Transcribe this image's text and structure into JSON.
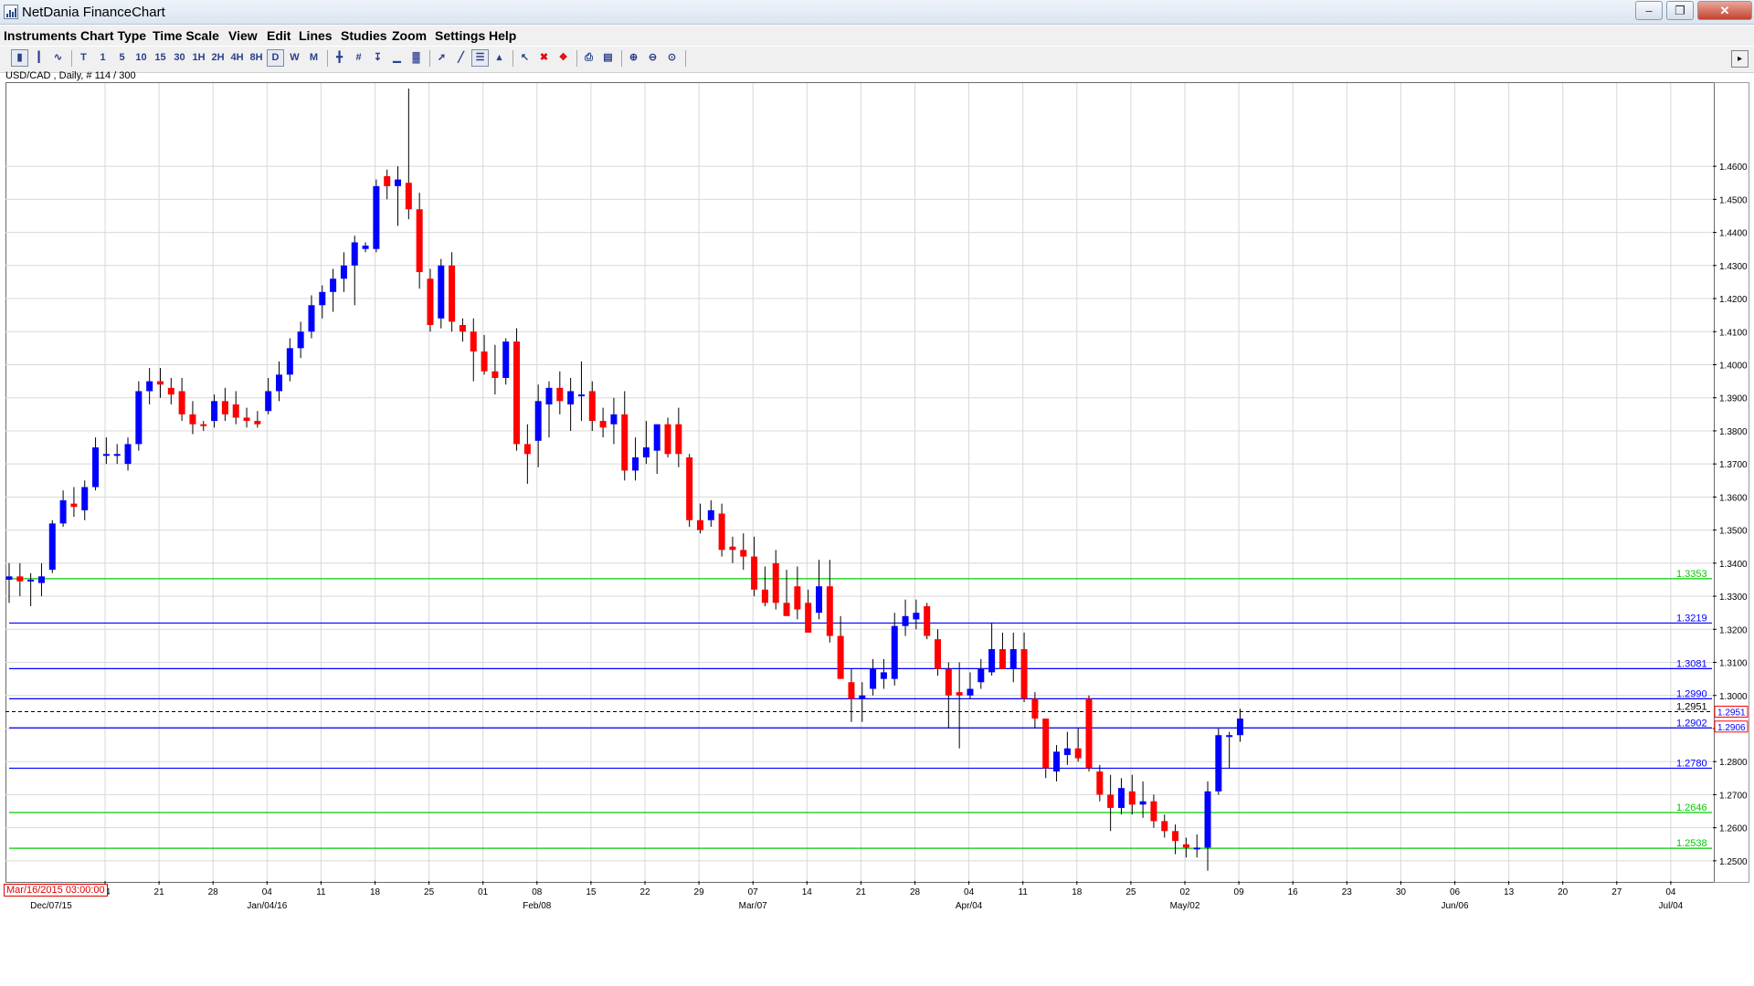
{
  "window": {
    "title": "NetDania FinanceChart",
    "controls": [
      "minimize",
      "maximize",
      "close"
    ]
  },
  "menu": [
    "Instruments",
    "Chart Type",
    "Time Scale",
    "View",
    "Edit",
    "Lines",
    "Studies",
    "Zoom",
    "Settings",
    "Help"
  ],
  "toolbar": {
    "timescale_buttons": [
      "T",
      "1",
      "5",
      "10",
      "15",
      "30",
      "1H",
      "2H",
      "4H",
      "8H",
      "D",
      "W",
      "M"
    ],
    "selected_timescale": "D"
  },
  "chart_label": "USD/CAD , Daily, # 114 / 300",
  "crosshair_date": "Mar/16/2015 03:00:00",
  "colors": {
    "bull": "#0000ff",
    "bear": "#ff0000",
    "support_line": "#00cc00",
    "resistance_line": "#0000ff",
    "current_price_line": "#000000",
    "grid": "#d8d8d8"
  },
  "chart_data": {
    "type": "candlestick",
    "symbol": "USD/CAD",
    "interval": "Daily",
    "ylim": [
      1.245,
      1.4835
    ],
    "yticks": [
      "1.2500",
      "1.2600",
      "1.2700",
      "1.2800",
      "1.2900",
      "1.3000",
      "1.3100",
      "1.3200",
      "1.3300",
      "1.3400",
      "1.3500",
      "1.3600",
      "1.3700",
      "1.3800",
      "1.3900",
      "1.4000",
      "1.4100",
      "1.4200",
      "1.4300",
      "1.4400",
      "1.4500",
      "1.4600"
    ],
    "xticks": [
      "14",
      "21",
      "28",
      "04",
      "11",
      "18",
      "25",
      "01",
      "08",
      "15",
      "22",
      "29",
      "07",
      "14",
      "21",
      "28",
      "04",
      "11",
      "18",
      "25",
      "02",
      "09",
      "16",
      "23",
      "30",
      "06",
      "13",
      "20",
      "27",
      "04"
    ],
    "month_labels": [
      {
        "tick_index": -1,
        "text": "Dec/07/15"
      },
      {
        "tick_index": 3,
        "text": "Jan/04/16"
      },
      {
        "tick_index": 8,
        "text": "Feb/08"
      },
      {
        "tick_index": 12,
        "text": "Mar/07"
      },
      {
        "tick_index": 16,
        "text": "Apr/04"
      },
      {
        "tick_index": 20,
        "text": "May/02"
      },
      {
        "tick_index": 25,
        "text": "Jun/06"
      },
      {
        "tick_index": 29,
        "text": "Jul/04"
      }
    ],
    "hlines": [
      {
        "value": 1.3353,
        "label": "1.3353",
        "color": "#00cc00"
      },
      {
        "value": 1.3219,
        "label": "1.3219",
        "color": "#0000ff"
      },
      {
        "value": 1.3081,
        "label": "1.3081",
        "color": "#0000ff"
      },
      {
        "value": 1.299,
        "label": "1.2990",
        "color": "#0000ff"
      },
      {
        "value": 1.2902,
        "label": "1.2902",
        "color": "#0000ff"
      },
      {
        "value": 1.278,
        "label": "1.2780",
        "color": "#0000ff"
      },
      {
        "value": 1.2646,
        "label": "1.2646",
        "color": "#00cc00"
      },
      {
        "value": 1.2538,
        "label": "1.2538",
        "color": "#00cc00"
      }
    ],
    "current_price": {
      "value": 1.2951,
      "label": "1.2951"
    },
    "axis_markers": [
      {
        "value": 1.2951,
        "label": "1.2951"
      },
      {
        "value": 1.2906,
        "label": "1.2906"
      }
    ],
    "candles": [
      [
        1.335,
        1.34,
        1.328,
        1.336
      ],
      [
        1.336,
        1.34,
        1.33,
        1.3345
      ],
      [
        1.3345,
        1.337,
        1.327,
        1.335
      ],
      [
        1.334,
        1.34,
        1.33,
        1.336
      ],
      [
        1.338,
        1.353,
        1.337,
        1.352
      ],
      [
        1.352,
        1.362,
        1.351,
        1.359
      ],
      [
        1.358,
        1.363,
        1.354,
        1.357
      ],
      [
        1.356,
        1.365,
        1.353,
        1.363
      ],
      [
        1.363,
        1.378,
        1.362,
        1.375
      ],
      [
        1.373,
        1.378,
        1.37,
        1.373
      ],
      [
        1.373,
        1.376,
        1.37,
        1.373
      ],
      [
        1.37,
        1.378,
        1.368,
        1.376
      ],
      [
        1.376,
        1.395,
        1.374,
        1.392
      ],
      [
        1.392,
        1.399,
        1.388,
        1.395
      ],
      [
        1.395,
        1.399,
        1.39,
        1.394
      ],
      [
        1.393,
        1.396,
        1.388,
        1.391
      ],
      [
        1.392,
        1.396,
        1.383,
        1.385
      ],
      [
        1.385,
        1.389,
        1.379,
        1.382
      ],
      [
        1.382,
        1.383,
        1.38,
        1.3815
      ],
      [
        1.383,
        1.391,
        1.381,
        1.389
      ],
      [
        1.389,
        1.393,
        1.383,
        1.385
      ],
      [
        1.388,
        1.392,
        1.382,
        1.384
      ],
      [
        1.384,
        1.387,
        1.381,
        1.383
      ],
      [
        1.383,
        1.386,
        1.381,
        1.382
      ],
      [
        1.386,
        1.396,
        1.385,
        1.392
      ],
      [
        1.392,
        1.401,
        1.389,
        1.397
      ],
      [
        1.397,
        1.408,
        1.395,
        1.405
      ],
      [
        1.405,
        1.413,
        1.402,
        1.41
      ],
      [
        1.41,
        1.421,
        1.408,
        1.418
      ],
      [
        1.418,
        1.424,
        1.414,
        1.422
      ],
      [
        1.422,
        1.429,
        1.416,
        1.426
      ],
      [
        1.426,
        1.434,
        1.422,
        1.43
      ],
      [
        1.43,
        1.439,
        1.418,
        1.437
      ],
      [
        1.435,
        1.437,
        1.434,
        1.436
      ],
      [
        1.435,
        1.456,
        1.434,
        1.454
      ],
      [
        1.457,
        1.459,
        1.45,
        1.454
      ],
      [
        1.454,
        1.46,
        1.442,
        1.456
      ],
      [
        1.455,
        1.4835,
        1.444,
        1.447
      ],
      [
        1.447,
        1.452,
        1.423,
        1.428
      ],
      [
        1.426,
        1.429,
        1.41,
        1.412
      ],
      [
        1.414,
        1.432,
        1.411,
        1.43
      ],
      [
        1.43,
        1.434,
        1.41,
        1.413
      ],
      [
        1.412,
        1.414,
        1.407,
        1.41
      ],
      [
        1.41,
        1.414,
        1.395,
        1.404
      ],
      [
        1.404,
        1.409,
        1.397,
        1.398
      ],
      [
        1.398,
        1.406,
        1.391,
        1.396
      ],
      [
        1.396,
        1.408,
        1.394,
        1.407
      ],
      [
        1.407,
        1.411,
        1.374,
        1.376
      ],
      [
        1.376,
        1.382,
        1.364,
        1.373
      ],
      [
        1.377,
        1.394,
        1.369,
        1.389
      ],
      [
        1.388,
        1.395,
        1.378,
        1.393
      ],
      [
        1.393,
        1.398,
        1.385,
        1.389
      ],
      [
        1.388,
        1.396,
        1.38,
        1.392
      ],
      [
        1.391,
        1.401,
        1.383,
        1.391
      ],
      [
        1.392,
        1.395,
        1.38,
        1.383
      ],
      [
        1.383,
        1.387,
        1.378,
        1.381
      ],
      [
        1.382,
        1.39,
        1.376,
        1.385
      ],
      [
        1.385,
        1.392,
        1.365,
        1.368
      ],
      [
        1.368,
        1.378,
        1.365,
        1.372
      ],
      [
        1.372,
        1.383,
        1.37,
        1.375
      ],
      [
        1.374,
        1.381,
        1.367,
        1.382
      ],
      [
        1.382,
        1.384,
        1.372,
        1.373
      ],
      [
        1.382,
        1.387,
        1.369,
        1.373
      ],
      [
        1.372,
        1.373,
        1.351,
        1.353
      ],
      [
        1.353,
        1.358,
        1.349,
        1.35
      ],
      [
        1.353,
        1.359,
        1.351,
        1.356
      ],
      [
        1.355,
        1.358,
        1.342,
        1.344
      ],
      [
        1.345,
        1.348,
        1.34,
        1.344
      ],
      [
        1.344,
        1.349,
        1.338,
        1.342
      ],
      [
        1.342,
        1.348,
        1.33,
        1.332
      ],
      [
        1.332,
        1.339,
        1.327,
        1.328
      ],
      [
        1.34,
        1.344,
        1.326,
        1.328
      ],
      [
        1.328,
        1.338,
        1.325,
        1.324
      ],
      [
        1.333,
        1.339,
        1.323,
        1.326
      ],
      [
        1.328,
        1.332,
        1.321,
        1.319
      ],
      [
        1.325,
        1.341,
        1.323,
        1.333
      ],
      [
        1.333,
        1.341,
        1.316,
        1.318
      ],
      [
        1.318,
        1.324,
        1.305,
        1.305
      ],
      [
        1.304,
        1.308,
        1.292,
        1.299
      ],
      [
        1.299,
        1.304,
        1.292,
        1.3
      ],
      [
        1.302,
        1.311,
        1.3,
        1.308
      ],
      [
        1.305,
        1.311,
        1.302,
        1.307
      ],
      [
        1.305,
        1.325,
        1.303,
        1.321
      ],
      [
        1.321,
        1.329,
        1.318,
        1.324
      ],
      [
        1.323,
        1.329,
        1.32,
        1.325
      ],
      [
        1.327,
        1.328,
        1.317,
        1.318
      ],
      [
        1.317,
        1.32,
        1.306,
        1.308
      ],
      [
        1.308,
        1.31,
        1.29,
        1.3
      ],
      [
        1.301,
        1.31,
        1.284,
        1.3
      ],
      [
        1.3,
        1.307,
        1.299,
        1.302
      ],
      [
        1.304,
        1.311,
        1.302,
        1.308
      ],
      [
        1.307,
        1.322,
        1.306,
        1.314
      ],
      [
        1.314,
        1.319,
        1.308,
        1.308
      ],
      [
        1.308,
        1.319,
        1.304,
        1.314
      ],
      [
        1.314,
        1.319,
        1.298,
        1.299
      ],
      [
        1.299,
        1.301,
        1.29,
        1.293
      ],
      [
        1.293,
        1.293,
        1.275,
        1.278
      ],
      [
        1.277,
        1.285,
        1.274,
        1.283
      ],
      [
        1.282,
        1.289,
        1.279,
        1.284
      ],
      [
        1.284,
        1.29,
        1.28,
        1.281
      ],
      [
        1.299,
        1.3,
        1.277,
        1.278
      ],
      [
        1.277,
        1.279,
        1.268,
        1.27
      ],
      [
        1.27,
        1.276,
        1.259,
        1.266
      ],
      [
        1.266,
        1.275,
        1.264,
        1.272
      ],
      [
        1.271,
        1.276,
        1.264,
        1.267
      ],
      [
        1.267,
        1.274,
        1.263,
        1.268
      ],
      [
        1.268,
        1.27,
        1.26,
        1.262
      ],
      [
        1.262,
        1.264,
        1.257,
        1.259
      ],
      [
        1.259,
        1.261,
        1.252,
        1.256
      ],
      [
        1.255,
        1.257,
        1.251,
        1.254
      ],
      [
        1.254,
        1.258,
        1.251,
        1.254
      ],
      [
        1.254,
        1.274,
        1.247,
        1.271
      ],
      [
        1.271,
        1.29,
        1.27,
        1.288
      ],
      [
        1.288,
        1.289,
        1.278,
        1.288
      ],
      [
        1.288,
        1.296,
        1.286,
        1.293
      ]
    ]
  }
}
